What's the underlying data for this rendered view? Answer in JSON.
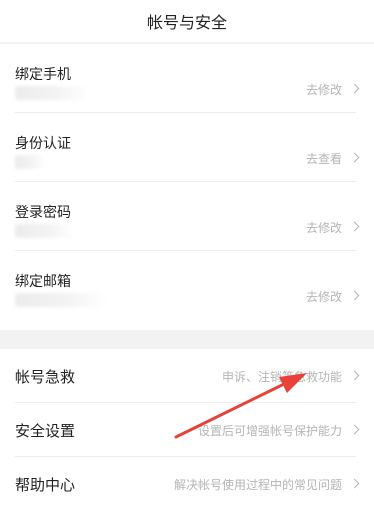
{
  "header": {
    "title": "帐号与安全"
  },
  "section1": {
    "items": [
      {
        "label": "绑定手机",
        "action": "去修改"
      },
      {
        "label": "身份认证",
        "action": "去查看"
      },
      {
        "label": "登录密码",
        "action": "去修改"
      },
      {
        "label": "绑定邮箱",
        "action": "去修改"
      }
    ]
  },
  "section2": {
    "items": [
      {
        "label": "帐号急救",
        "action": "申诉、注销等急救功能"
      },
      {
        "label": "安全设置",
        "action": "设置后可增强帐号保护能力"
      },
      {
        "label": "帮助中心",
        "action": "解决帐号使用过程中的常见问题"
      }
    ]
  },
  "annotation": {
    "arrow_color": "#e8413a"
  }
}
